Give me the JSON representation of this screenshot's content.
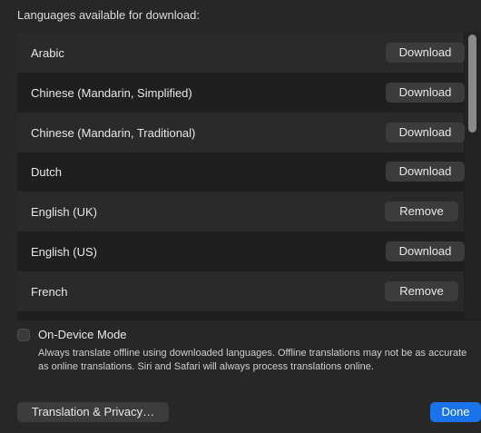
{
  "header": {
    "title": "Languages available for download:"
  },
  "languages": [
    {
      "name": "Arabic",
      "action": "Download"
    },
    {
      "name": "Chinese (Mandarin, Simplified)",
      "action": "Download"
    },
    {
      "name": "Chinese (Mandarin, Traditional)",
      "action": "Download"
    },
    {
      "name": "Dutch",
      "action": "Download"
    },
    {
      "name": "English (UK)",
      "action": "Remove"
    },
    {
      "name": "English (US)",
      "action": "Download"
    },
    {
      "name": "French",
      "action": "Remove"
    }
  ],
  "on_device": {
    "label": "On-Device Mode",
    "checked": false,
    "description": "Always translate offline using downloaded languages. Offline translations may not be as accurate as online translations. Siri and Safari will always process translations online."
  },
  "footer": {
    "privacy_button": "Translation & Privacy…",
    "done_button": "Done"
  },
  "colors": {
    "accent": "#1a73e8",
    "background": "#272727",
    "list_background": "#1f1f1f",
    "row_alt": "#2a2a2a",
    "button": "#3c3c3c"
  }
}
